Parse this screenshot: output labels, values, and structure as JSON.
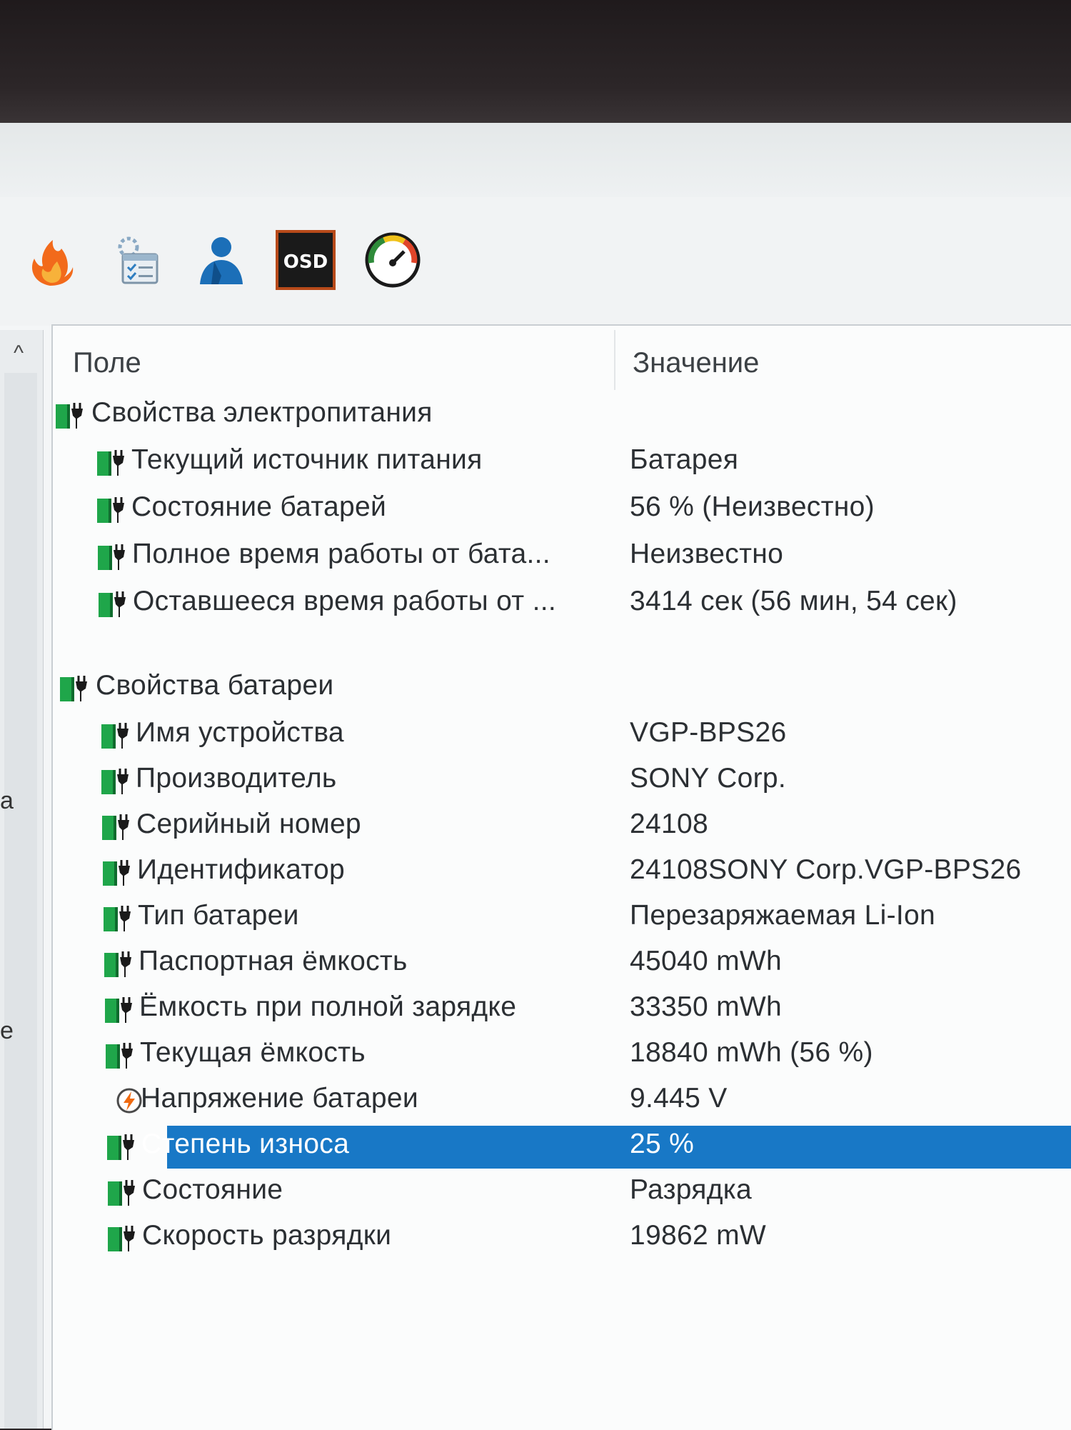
{
  "toolbar": {
    "icons": [
      {
        "name": "flame-icon",
        "color": "#f26a1b"
      },
      {
        "name": "scheduler-icon",
        "color": "#7aa3c2"
      },
      {
        "name": "user-icon",
        "color": "#1c6fb8"
      },
      {
        "name": "osd-icon",
        "label": "OSD",
        "color": "#1a1a1a"
      },
      {
        "name": "gauge-icon",
        "color": "#2e8b3a"
      }
    ]
  },
  "table": {
    "columns": {
      "field": "Поле",
      "value": "Значение"
    },
    "groups": [
      {
        "title": "Свойства электропитания",
        "rows": [
          {
            "field": "Текущий источник питания",
            "value": "Батарея"
          },
          {
            "field": "Состояние батарей",
            "value": "56 % (Неизвестно)"
          },
          {
            "field": "Полное время работы от бата...",
            "value": "Неизвестно"
          },
          {
            "field": "Оставшееся время работы от ...",
            "value": "3414 сек (56 мин, 54 сек)"
          }
        ]
      },
      {
        "title": "Свойства батареи",
        "rows": [
          {
            "field": "Имя устройства",
            "value": "VGP-BPS26"
          },
          {
            "field": "Производитель",
            "value": "SONY Corp."
          },
          {
            "field": "Серийный номер",
            "value": "24108"
          },
          {
            "field": "Идентификатор",
            "value": "24108SONY Corp.VGP-BPS26"
          },
          {
            "field": "Тип батареи",
            "value": "Перезаряжаемая Li-Ion"
          },
          {
            "field": "Паспортная ёмкость",
            "value": "45040 mWh"
          },
          {
            "field": "Ёмкость при полной зарядке",
            "value": "33350 mWh"
          },
          {
            "field": "Текущая ёмкость",
            "value": "18840 mWh  (56 %)"
          },
          {
            "field": "Напряжение батареи",
            "value": "9.445 V",
            "icon": "voltage-icon"
          },
          {
            "field": "Степень износа",
            "value": "25 %",
            "selected": true
          },
          {
            "field": "Состояние",
            "value": "Разрядка"
          },
          {
            "field": "Скорость разрядки",
            "value": "19862 mW"
          }
        ]
      }
    ]
  },
  "left_edge": {
    "letter_1": "a",
    "letter_2": "e"
  },
  "colors": {
    "selection": "#1878c6",
    "battery_green": "#1fa64a"
  }
}
